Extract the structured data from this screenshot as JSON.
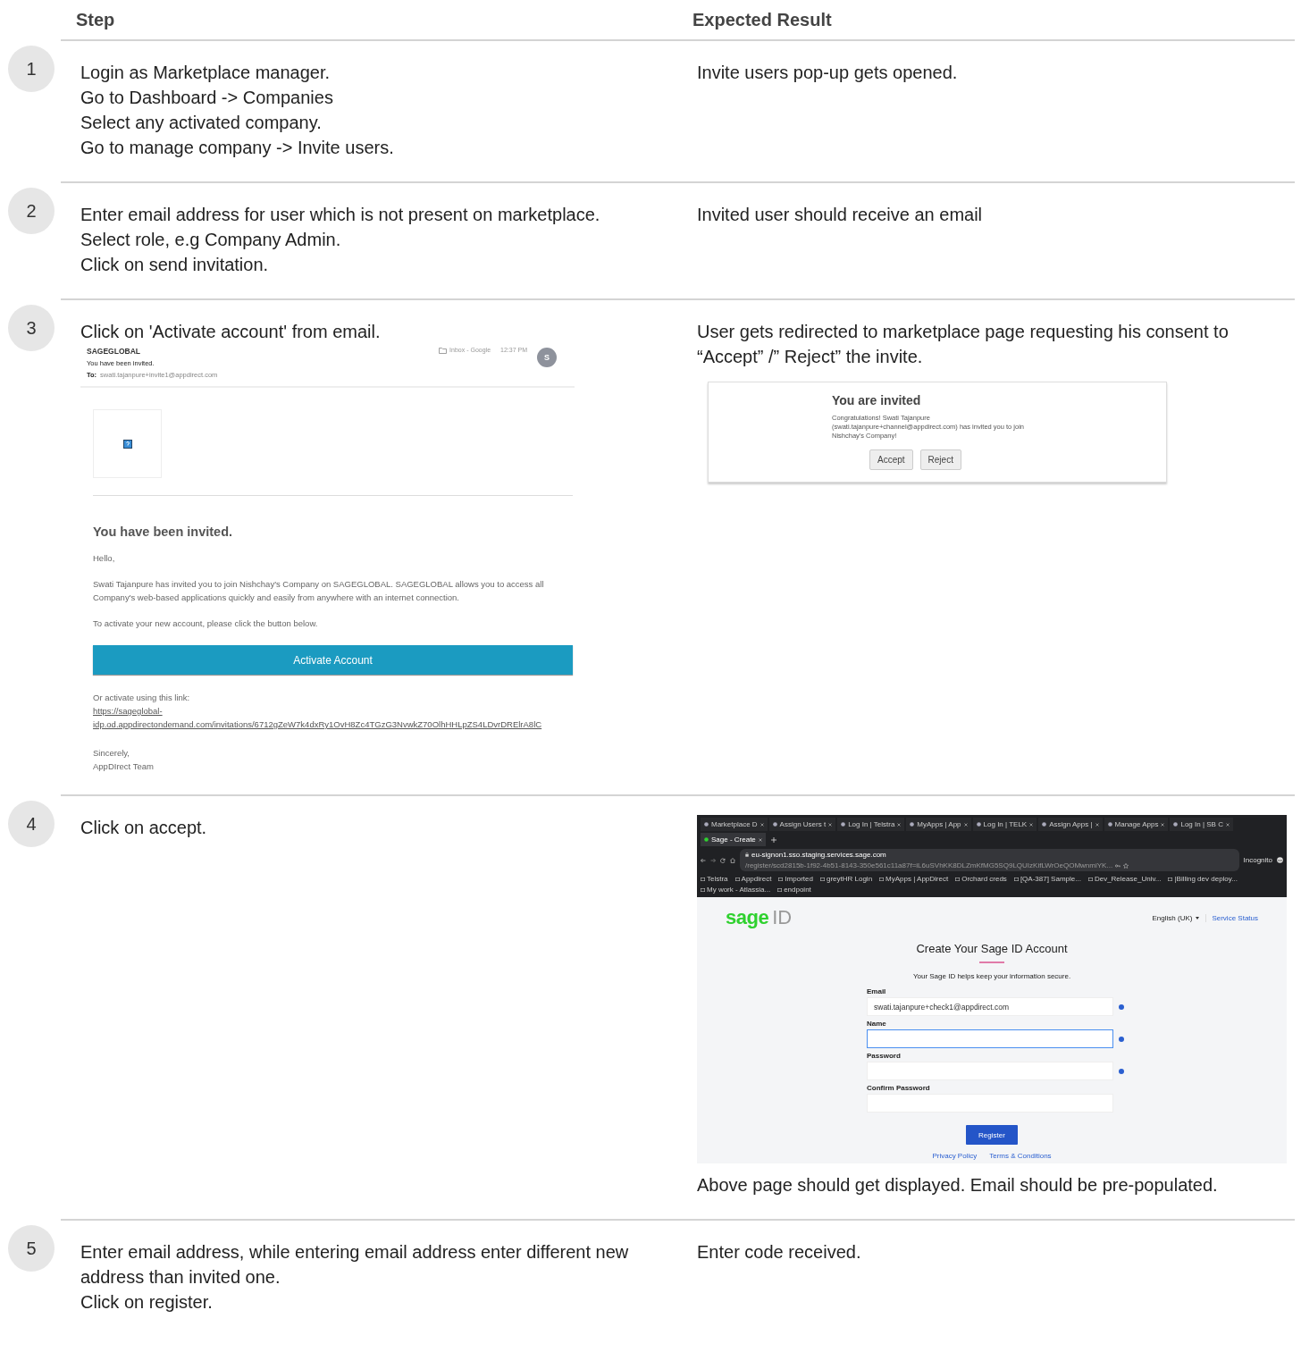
{
  "columns": [
    {
      "label": "Step"
    },
    {
      "label": "Expected Result"
    }
  ],
  "rows": [
    {
      "number": "1",
      "step": [
        {
          "kind": "text",
          "lines": [
            "Login as Marketplace manager.",
            "Go to Dashboard -> Companies",
            "Select any activated company.",
            "Go to manage company -> Invite users."
          ]
        }
      ],
      "expected": [
        {
          "kind": "text",
          "lines": [
            "Invite users pop-up gets opened."
          ]
        }
      ]
    },
    {
      "number": "2",
      "step": [
        {
          "kind": "text",
          "lines": [
            "Enter email address for user which is not present on marketplace.",
            "Select role, e.g Company Admin.",
            "Click on send invitation."
          ]
        }
      ],
      "expected": [
        {
          "kind": "text",
          "lines": [
            "Invited user should receive an email"
          ]
        }
      ]
    },
    {
      "number": "3",
      "step": [
        {
          "kind": "text",
          "lines": [
            "Click on 'Activate account' from email."
          ]
        },
        {
          "kind": "email",
          "sender": "SAGEGLOBAL",
          "subject": "You have been invited.",
          "to_label": "To:",
          "to": "swati.tajanpure+invite1@appdirect.com",
          "folder": "Inbox - Google",
          "time": "12:37 PM",
          "avatar": "S",
          "heading": "You have been invited.",
          "greeting": "Hello,",
          "body": "Swati Tajanpure has invited you to join Nishchay's Company on SAGEGLOBAL. SAGEGLOBAL allows you to access all Company's web-based applications quickly and easily from anywhere with an internet connection.",
          "instruction": "To activate your new account, please click the button below.",
          "button": "Activate Account",
          "link_intro": "Or activate using this link:",
          "link": [
            "https://sageglobal-",
            "idp.od.appdirectondemand.com/invitations/6712gZeW7k4dxRy1OvH8Zc4TGzG3NvwkZ70OlhHHLpZS4LDvrDRElrA8lC"
          ],
          "signoff": [
            "Sincerely,",
            "AppDIrect Team"
          ]
        }
      ],
      "expected": [
        {
          "kind": "text",
          "lines": [
            "User gets redirected to marketplace page requesting his consent to “Accept” /” Reject” the invite."
          ]
        },
        {
          "kind": "invite_dialog",
          "title": "You are invited",
          "message": "Congratulations! Swati Tajanpure (swati.tajanpure+channel@appdirect.com) has invited you to join Nishchay's Company!",
          "buttons": [
            "Accept",
            "Reject"
          ]
        }
      ]
    },
    {
      "number": "4",
      "step": [
        {
          "kind": "text",
          "lines": [
            "Click on accept."
          ]
        }
      ],
      "expected": [
        {
          "kind": "browser",
          "tabs": [
            {
              "label": "Marketplace D",
              "selected": false
            },
            {
              "label": "Assign Users t",
              "selected": false
            },
            {
              "label": "Log In | Telstra",
              "selected": false
            },
            {
              "label": "MyApps | App",
              "selected": false
            },
            {
              "label": "Log In | TELK",
              "selected": false
            },
            {
              "label": "Assign Apps |",
              "selected": false
            },
            {
              "label": "Manage Apps",
              "selected": false
            },
            {
              "label": "Log In | SB C",
              "selected": false
            },
            {
              "label": "Sage - Create",
              "selected": true
            }
          ],
          "url_host": "eu-signon1.sso.staging.services.sage.com",
          "url_path": "/register/scd2815b-1f92-4b51-8143-350e561c11a87f=iL6uSVhKK8DLZmKfMG5SQ9LQUIzKifLWrOeQOMwnmiYK...",
          "profile": "Incognito",
          "bookmarks": [
            "Telstra",
            "Appdirect",
            "Imported",
            "greytHR Login",
            "MyApps | AppDirect",
            "Orchard creds",
            "[QA-387] Sample...",
            "Dev_Release_Univ...",
            "|Billing dev deploy...",
            "My work - Atlassia...",
            "endpoint"
          ],
          "logo_brand": "sage",
          "logo_suffix": "ID",
          "language": "English (UK)",
          "service_link": "Service Status",
          "title": "Create Your Sage ID Account",
          "subtitle": "Your Sage ID helps keep your information secure.",
          "fields": [
            {
              "label": "Email",
              "value": "swati.tajanpure+check1@appdirect.com",
              "focused": false,
              "help": true
            },
            {
              "label": "Name",
              "focused": true,
              "help": true
            },
            {
              "label": "Password",
              "focused": false,
              "help": true
            },
            {
              "label": "Confirm Password",
              "focused": false,
              "help": false
            }
          ],
          "button": "Register",
          "footer_links": [
            "Privacy Policy",
            "Terms & Conditions"
          ]
        },
        {
          "kind": "text",
          "lines": [
            "Above page should get displayed. Email should be pre-populated."
          ]
        }
      ]
    },
    {
      "number": "5",
      "step": [
        {
          "kind": "text",
          "lines": [
            "Enter email address, while entering email address enter different new address than invited one.",
            "Click on register."
          ]
        }
      ],
      "expected": [
        {
          "kind": "text",
          "lines": [
            "Enter code received."
          ]
        }
      ]
    }
  ]
}
